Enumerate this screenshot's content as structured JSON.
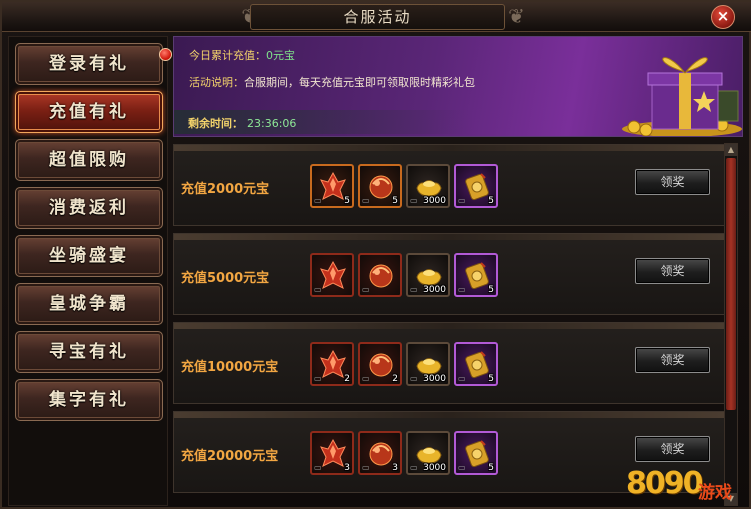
{
  "window": {
    "title": "合服活动",
    "close_label": "×"
  },
  "sidebar": {
    "items": [
      {
        "label": "登录有礼",
        "active": false,
        "has_notice": true
      },
      {
        "label": "充值有礼",
        "active": true,
        "has_notice": false
      },
      {
        "label": "超值限购",
        "active": false,
        "has_notice": false
      },
      {
        "label": "消费返利",
        "active": false,
        "has_notice": false
      },
      {
        "label": "坐骑盛宴",
        "active": false,
        "has_notice": false
      },
      {
        "label": "皇城争霸",
        "active": false,
        "has_notice": false
      },
      {
        "label": "寻宝有礼",
        "active": false,
        "has_notice": false
      },
      {
        "label": "集字有礼",
        "active": false,
        "has_notice": false
      }
    ]
  },
  "banner": {
    "recharge_key": "今日累计充值：",
    "recharge_value": "0元宝",
    "desc_key": "活动说明：",
    "desc_value": "合服期间，每天充值元宝即可领取限时精彩礼包",
    "timer_key": "剩余时间：",
    "timer_value": "23:36:06"
  },
  "tiers": [
    {
      "label": "充值2000元宝",
      "button": "领奖",
      "items": [
        {
          "kind": "orange",
          "icon": "red-crystal-icon",
          "qty": "5"
        },
        {
          "kind": "orange",
          "icon": "red-orb-icon",
          "qty": "5"
        },
        {
          "kind": "plain",
          "icon": "gold-ingot-icon",
          "qty": "3000"
        },
        {
          "kind": "purple",
          "icon": "gold-token-icon",
          "qty": "5"
        }
      ]
    },
    {
      "label": "充值5000元宝",
      "button": "领奖",
      "items": [
        {
          "kind": "red",
          "icon": "red-crystal-icon",
          "qty": ""
        },
        {
          "kind": "red",
          "icon": "red-orb-icon",
          "qty": ""
        },
        {
          "kind": "plain",
          "icon": "gold-ingot-icon",
          "qty": "3000"
        },
        {
          "kind": "purple",
          "icon": "gold-token-icon",
          "qty": "5"
        }
      ]
    },
    {
      "label": "充值10000元宝",
      "button": "领奖",
      "items": [
        {
          "kind": "red",
          "icon": "red-crystal-icon",
          "qty": "2"
        },
        {
          "kind": "red",
          "icon": "red-orb-icon",
          "qty": "2"
        },
        {
          "kind": "plain",
          "icon": "gold-ingot-icon",
          "qty": "3000"
        },
        {
          "kind": "purple",
          "icon": "gold-token-icon",
          "qty": "5"
        }
      ]
    },
    {
      "label": "充值20000元宝",
      "button": "领奖",
      "items": [
        {
          "kind": "red",
          "icon": "red-crystal-icon",
          "qty": "3"
        },
        {
          "kind": "red",
          "icon": "red-orb-icon",
          "qty": "3"
        },
        {
          "kind": "plain",
          "icon": "gold-ingot-icon",
          "qty": "3000"
        },
        {
          "kind": "purple",
          "icon": "gold-token-icon",
          "qty": "5"
        }
      ]
    }
  ],
  "watermark": {
    "number": "8090",
    "text": "游戏"
  },
  "colors": {
    "accent": "#f2a642",
    "active_tab": "#b03a28",
    "banner": "#5a2677",
    "timer": "#8ee897"
  }
}
